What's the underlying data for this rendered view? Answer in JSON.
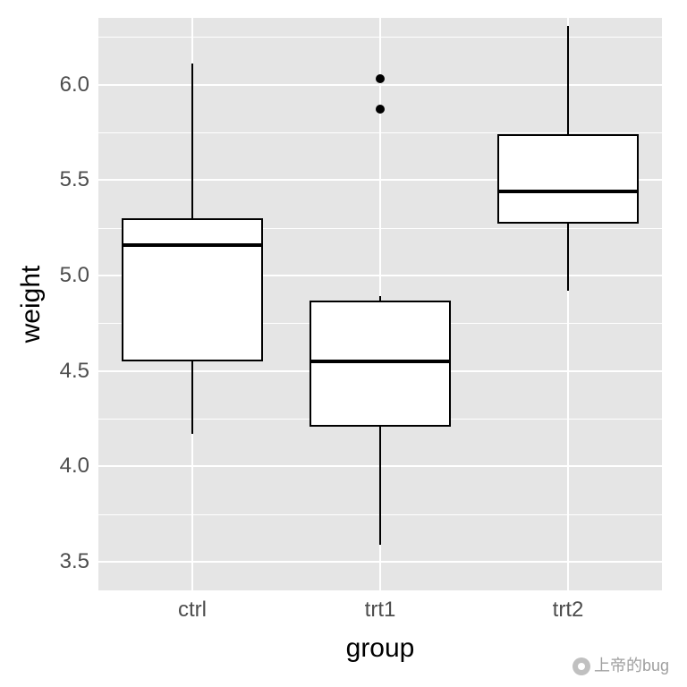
{
  "chart_data": {
    "type": "boxplot",
    "xlabel": "group",
    "ylabel": "weight",
    "categories": [
      "ctrl",
      "trt1",
      "trt2"
    ],
    "y_ticks": [
      3.5,
      4.0,
      4.5,
      5.0,
      5.5,
      6.0
    ],
    "y_minor_ticks": [
      3.75,
      4.25,
      4.75,
      5.25,
      5.75,
      6.25
    ],
    "ylim": [
      3.35,
      6.35
    ],
    "series": [
      {
        "name": "ctrl",
        "min": 4.17,
        "q1": 4.55,
        "median": 5.16,
        "q3": 5.3,
        "max": 6.11,
        "outliers": []
      },
      {
        "name": "trt1",
        "min": 3.59,
        "q1": 4.21,
        "median": 4.55,
        "q3": 4.87,
        "max": 4.89,
        "outliers": [
          5.87,
          6.03
        ]
      },
      {
        "name": "trt2",
        "min": 4.92,
        "q1": 5.27,
        "median": 5.44,
        "q3": 5.74,
        "max": 6.31,
        "outliers": []
      }
    ]
  },
  "watermark": {
    "text": "上帝的bug"
  }
}
